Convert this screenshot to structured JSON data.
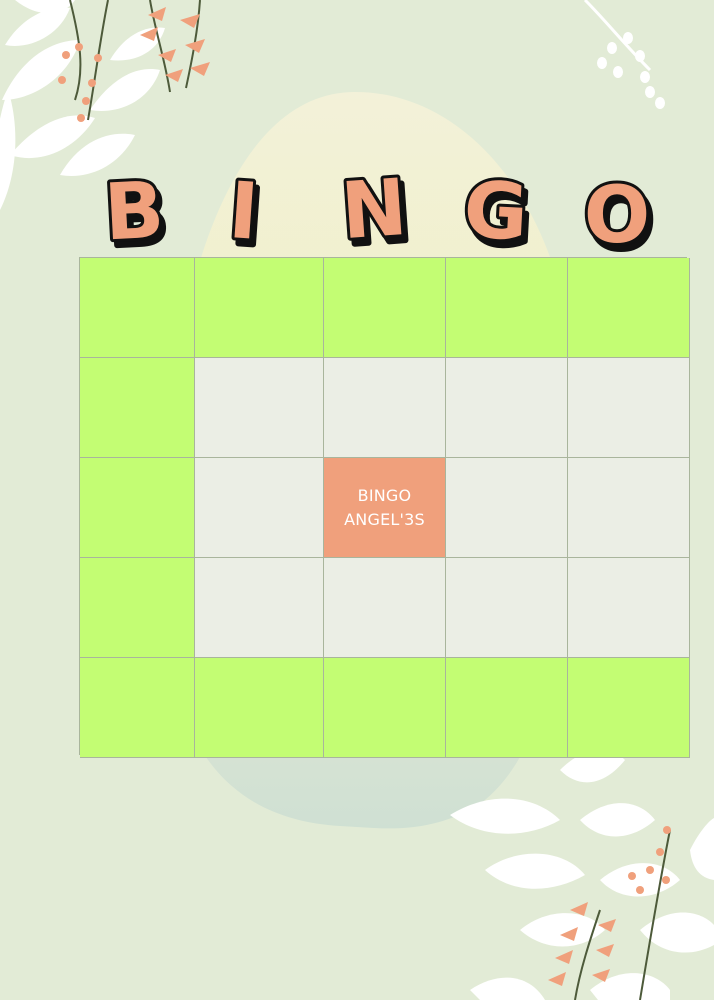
{
  "title": {
    "letters": [
      "B",
      "I",
      "N",
      "G",
      "O"
    ]
  },
  "board": {
    "columns": 5,
    "rows": 5,
    "free_space": {
      "line1": "BINGO",
      "line2": "ANGEL'3S"
    }
  },
  "colors": {
    "background": "#e2ebd6",
    "highlight_cell": "#c3fd73",
    "empty_cell": "#ebeee5",
    "free_cell": "#f0a07c",
    "title_fill": "#f0a07c",
    "title_outline": "#111111"
  },
  "decorations": {
    "top_left": "white-leaf-branch-with-coral-berries",
    "top_right": "white-berry-sprig",
    "bottom_right": "white-leaf-branch-with-coral-berries",
    "center_backdrop": "pale-yellow-egg-shape"
  }
}
